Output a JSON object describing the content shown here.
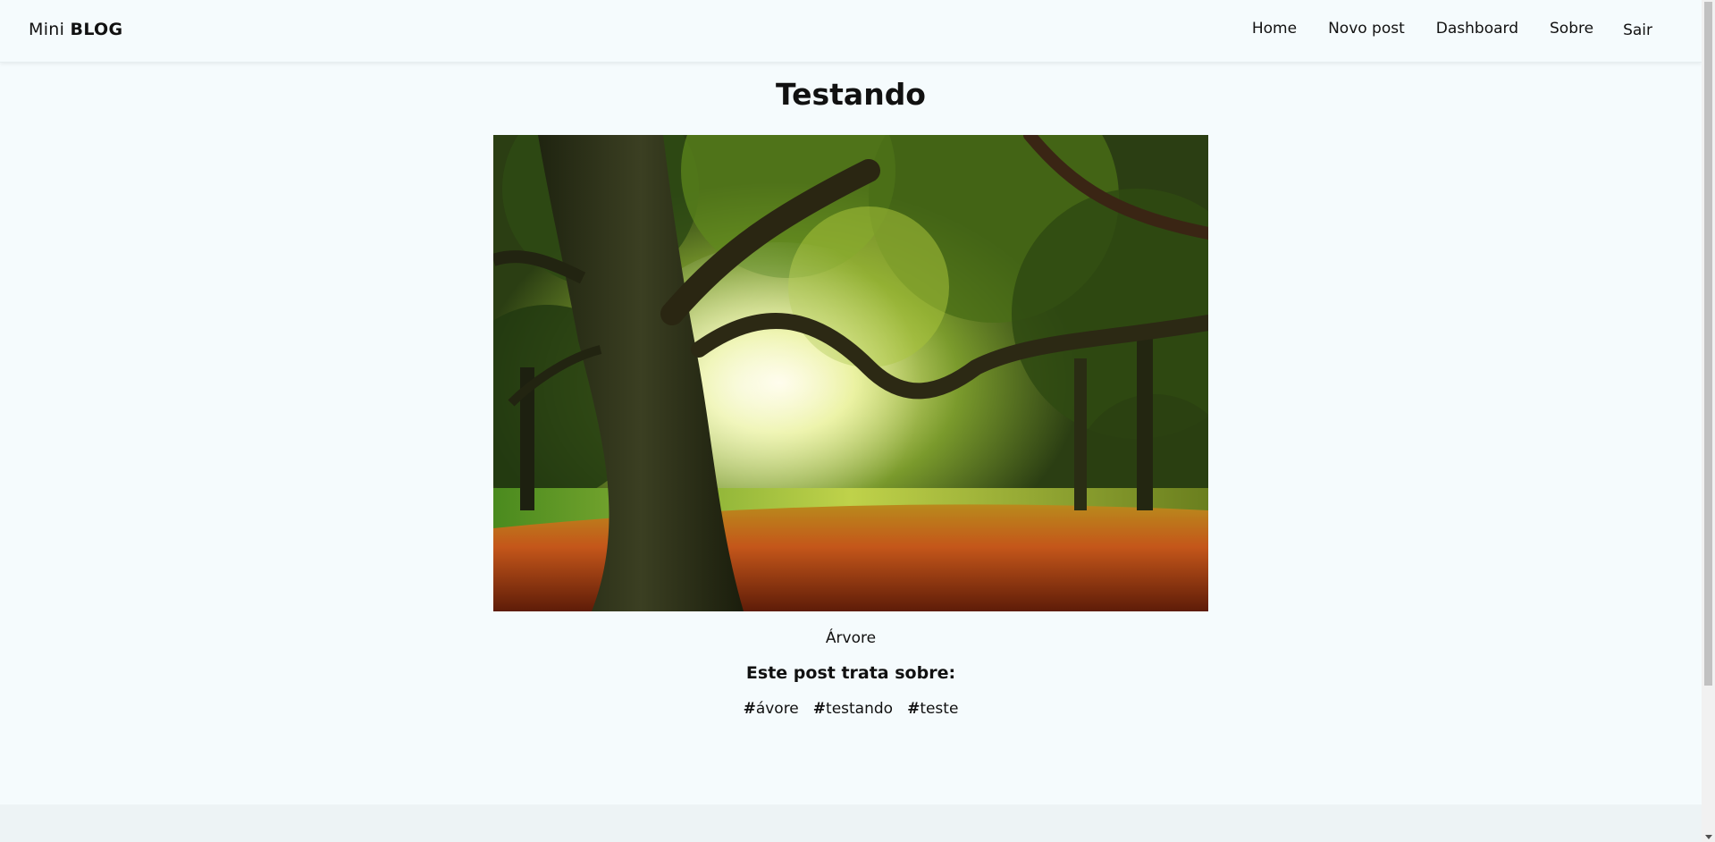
{
  "navbar": {
    "brand_light": "Mini",
    "brand_bold": "BLOG",
    "links": [
      "Home",
      "Novo post",
      "Dashboard",
      "Sobre"
    ],
    "logout_label": "Sair"
  },
  "post": {
    "title": "Testando",
    "image_alt": "Árvore",
    "caption": "Árvore",
    "tags_heading": "Este post trata sobre:",
    "tags": [
      "ávore",
      "testando",
      "teste"
    ]
  },
  "colors": {
    "background": "#f5fbfd",
    "footer": "#edf3f5",
    "text": "#111111"
  }
}
